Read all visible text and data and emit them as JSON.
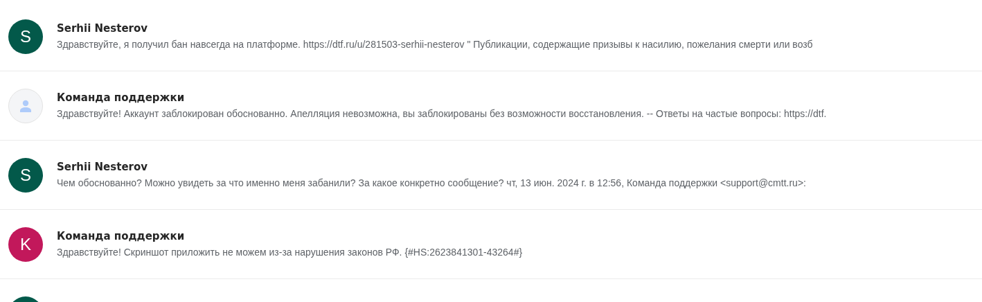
{
  "messages": [
    {
      "sender": "Serhii Nesterov",
      "avatar": {
        "kind": "letter",
        "letter": "S",
        "color": "#03594a"
      },
      "snippet": "Здравствуйте, я получил бан навсегда на платформе. https://dtf.ru/u/281503-serhii-nesterov \" Публикации, содержащие призывы к насилию, пожелания смерти или возб"
    },
    {
      "sender": "Команда поддержки",
      "avatar": {
        "kind": "placeholder"
      },
      "snippet": "Здравствуйте! Аккаунт заблокирован обоснованно. Апелляция невозможна, вы заблокированы без возможности восстановления. -- Ответы на частые вопросы: https://dtf."
    },
    {
      "sender": "Serhii Nesterov",
      "avatar": {
        "kind": "letter",
        "letter": "S",
        "color": "#03594a"
      },
      "snippet": "Чем обоснованно? Можно увидеть за что именно меня забанили? За какое конкретно сообщение? чт, 13 июн. 2024 г. в 12:56, Команда поддержки <support@cmtt.ru>:"
    },
    {
      "sender": "Команда поддержки",
      "avatar": {
        "kind": "letter",
        "letter": "K",
        "color": "#c2185b"
      },
      "snippet": "Здравствуйте! Скриншот приложить не можем из-за нарушения законов РФ. {#HS:2623841301-43264#}"
    },
    {
      "avatar": {
        "kind": "letter",
        "color": "#03594a"
      }
    }
  ]
}
